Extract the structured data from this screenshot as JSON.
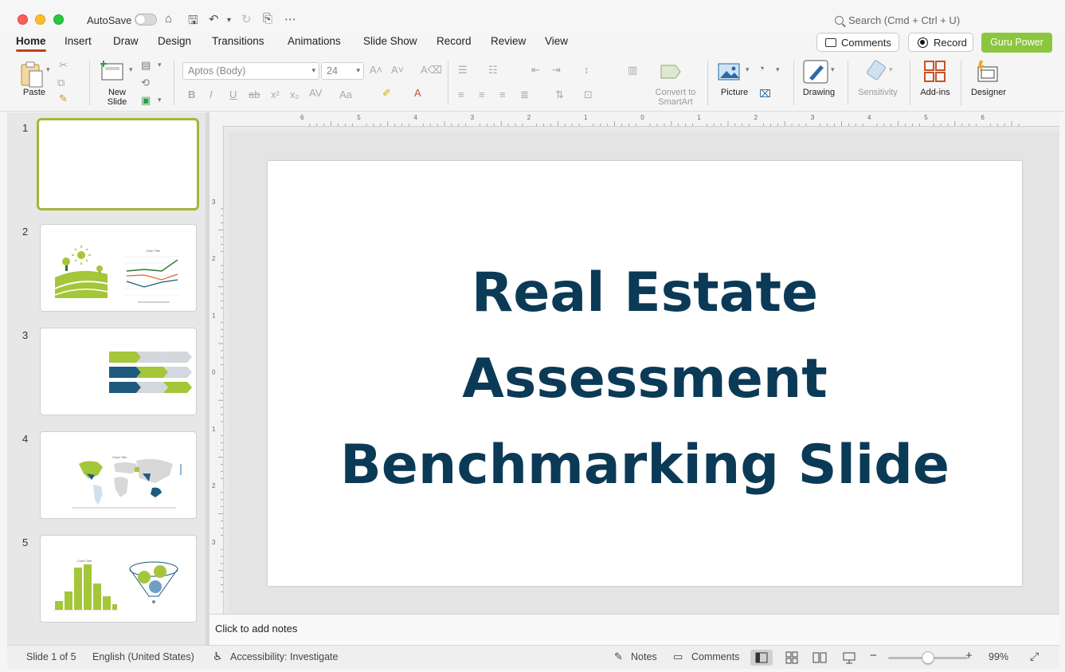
{
  "app": {
    "autosave_label": "AutoSave",
    "search_placeholder": "Search (Cmd + Ctrl + U)"
  },
  "tabs": [
    "Home",
    "Insert",
    "Draw",
    "Design",
    "Transitions",
    "Animations",
    "Slide Show",
    "Record",
    "Review",
    "View"
  ],
  "actions": {
    "comments": "Comments",
    "record": "Record",
    "guru": "Guru Power"
  },
  "ribbon": {
    "paste": "Paste",
    "new_slide": "New Slide",
    "font_name": "Aptos (Body)",
    "font_size": "24",
    "convert_smartart": "Convert to SmartArt",
    "picture": "Picture",
    "drawing": "Drawing",
    "sensitivity": "Sensitivity",
    "addins": "Add-ins",
    "designer": "Designer"
  },
  "thumbnails": [
    "1",
    "2",
    "3",
    "4",
    "5"
  ],
  "thumb_text": {
    "chart_title": "Chart Title"
  },
  "slide": {
    "title_lines": [
      "Real Estate",
      "Assessment",
      "Benchmarking Slide"
    ]
  },
  "notes_placeholder": "Click to add notes",
  "statusbar": {
    "slide_of": "Slide 1 of 5",
    "language": "English (United States)",
    "accessibility": "Accessibility: Investigate",
    "notes": "Notes",
    "comments": "Comments",
    "zoom": "99%"
  },
  "colors": {
    "title": "#0b3a57",
    "green": "#a4c639",
    "navy": "#1d5a7e",
    "guru": "#8cc63f"
  },
  "ruler_h": [
    "6",
    "5",
    "4",
    "3",
    "2",
    "1",
    "0",
    "1",
    "2",
    "3",
    "4",
    "5",
    "6"
  ],
  "ruler_v": [
    "3",
    "2",
    "1",
    "0",
    "1",
    "2",
    "3"
  ]
}
